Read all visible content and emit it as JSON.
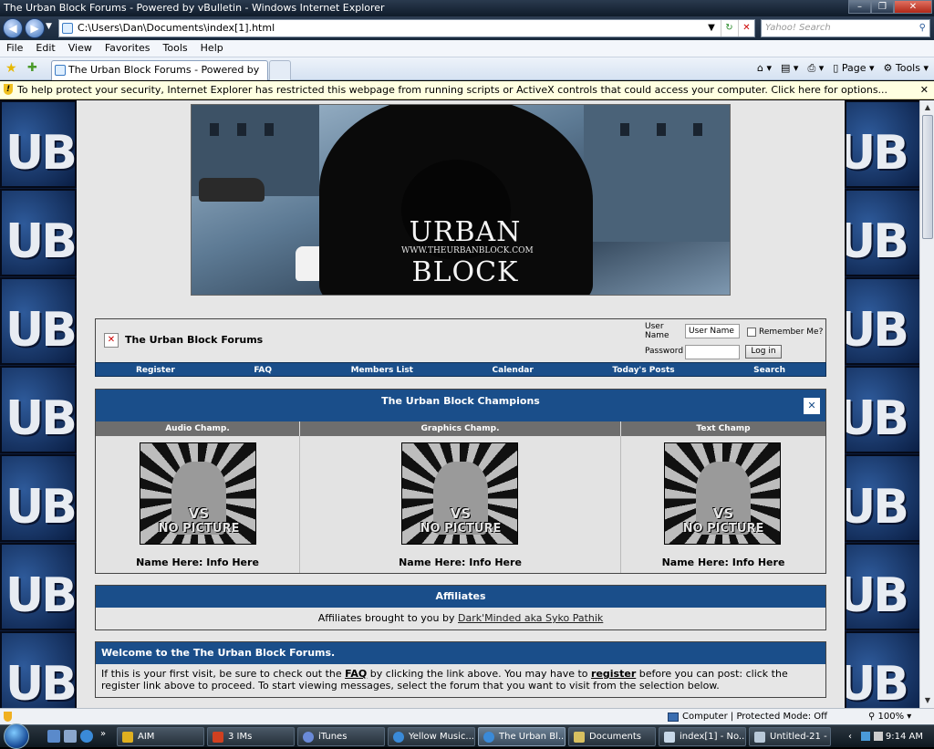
{
  "window": {
    "title": "The Urban Block Forums - Powered by vBulletin - Windows Internet Explorer"
  },
  "addressbar": {
    "url": "C:\\Users\\Dan\\Documents\\index[1].html",
    "search_placeholder": "Yahoo! Search"
  },
  "menu": [
    "File",
    "Edit",
    "View",
    "Favorites",
    "Tools",
    "Help"
  ],
  "tab": {
    "label": "The Urban Block Forums - Powered by vBulletin"
  },
  "commandbar": {
    "page": "Page",
    "tools": "Tools"
  },
  "infobar": {
    "text": "To help protect your security, Internet Explorer has restricted this webpage from running scripts or ActiveX controls that could access your computer. Click here for options..."
  },
  "background_tile_text": "UB",
  "banner": {
    "title_top": "URBAN",
    "url": "WWW.THEURBANBLOCK.COM",
    "title_bottom": "BLOCK"
  },
  "forum": {
    "title": "The Urban Block Forums",
    "login": {
      "username_label": "User Name",
      "username_value": "User Name",
      "password_label": "Password",
      "remember_label": "Remember Me?",
      "login_button": "Log in"
    },
    "nav": [
      "Register",
      "FAQ",
      "Members List",
      "Calendar",
      "Today's Posts",
      "Search"
    ]
  },
  "champions": {
    "title": "The Urban Block Champions",
    "columns": [
      "Audio Champ.",
      "Graphics Champ.",
      "Text Champ"
    ],
    "image_text_1": "VS",
    "image_text_2": "NO PICTURE",
    "entries": [
      "Name Here: Info Here",
      "Name Here: Info Here",
      "Name Here: Info Here"
    ]
  },
  "affiliates": {
    "title": "Affiliates",
    "text": "Affiliates brought to you by",
    "link": "Dark'Minded aka Syko Pathik"
  },
  "welcome": {
    "title": "Welcome to the The Urban Block Forums.",
    "p1": "If this is your first visit, be sure to check out the ",
    "faq": "FAQ",
    "p2": " by clicking the link above. You may have to ",
    "register": "register",
    "p3": " before you can post: click the register link above to proceed. To start viewing messages, select the forum that you want to visit from the selection below."
  },
  "statusbar": {
    "zone": "Computer | Protected Mode: Off",
    "zoom": "100%"
  },
  "taskbar": {
    "tasks": [
      "AIM",
      "3 IMs",
      "iTunes",
      "Yellow Music...",
      "The Urban Bl...",
      "Documents",
      "index[1] - No...",
      "Untitled-21 - ..."
    ],
    "clock": "9:14 AM"
  }
}
